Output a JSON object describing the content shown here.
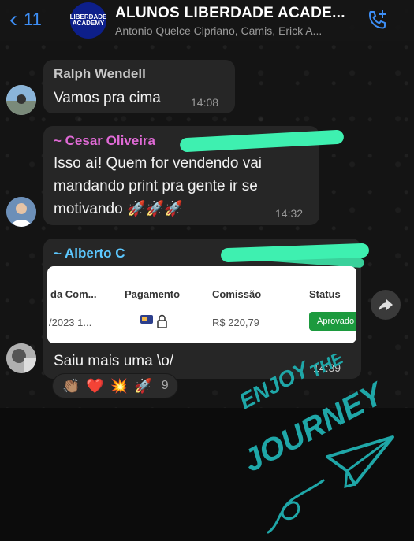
{
  "header": {
    "back_count": "11",
    "group_title": "ALUNOS LIBERDADE ACADE...",
    "group_subtitle": "Antonio Quelce Cipriano, Camis, Erick A...",
    "avatar_text_top": "LIBERDADE",
    "avatar_text_bottom": "ACADEMY"
  },
  "messages": [
    {
      "sender": "Ralph Wendell",
      "text": "Vamos pra cima",
      "time": "14:08"
    },
    {
      "sender": "~ Cesar Oliveira",
      "lines": [
        "Isso aí! Quem for vendendo vai",
        "mandando print pra gente ir se",
        "motivando 🚀🚀🚀"
      ],
      "time": "14:32"
    },
    {
      "sender": "~ Alberto C",
      "text": "Saiu mais uma \\o/",
      "time": "14:39"
    }
  ],
  "screenshot_card": {
    "headers": [
      "da Com...",
      "Pagamento",
      "Comissão",
      "Status"
    ],
    "row": {
      "date": "/2023 1...",
      "commission": "R$ 220,79",
      "status": "Aprovado"
    }
  },
  "reactions": {
    "emojis": [
      "👏🏽",
      "❤️",
      "💥",
      "🚀"
    ],
    "count": "9"
  },
  "sticker": {
    "line1": "ENJOY",
    "line2": "THE",
    "line3": "JOURNEY"
  },
  "colors": {
    "accent": "#3d8ef5",
    "sender_cesar": "#e06ad6",
    "sender_alberto": "#5cc8ff",
    "redaction": "#3ef0b0",
    "approved": "#1c9a3e",
    "sticker": "#1fa7a8"
  }
}
